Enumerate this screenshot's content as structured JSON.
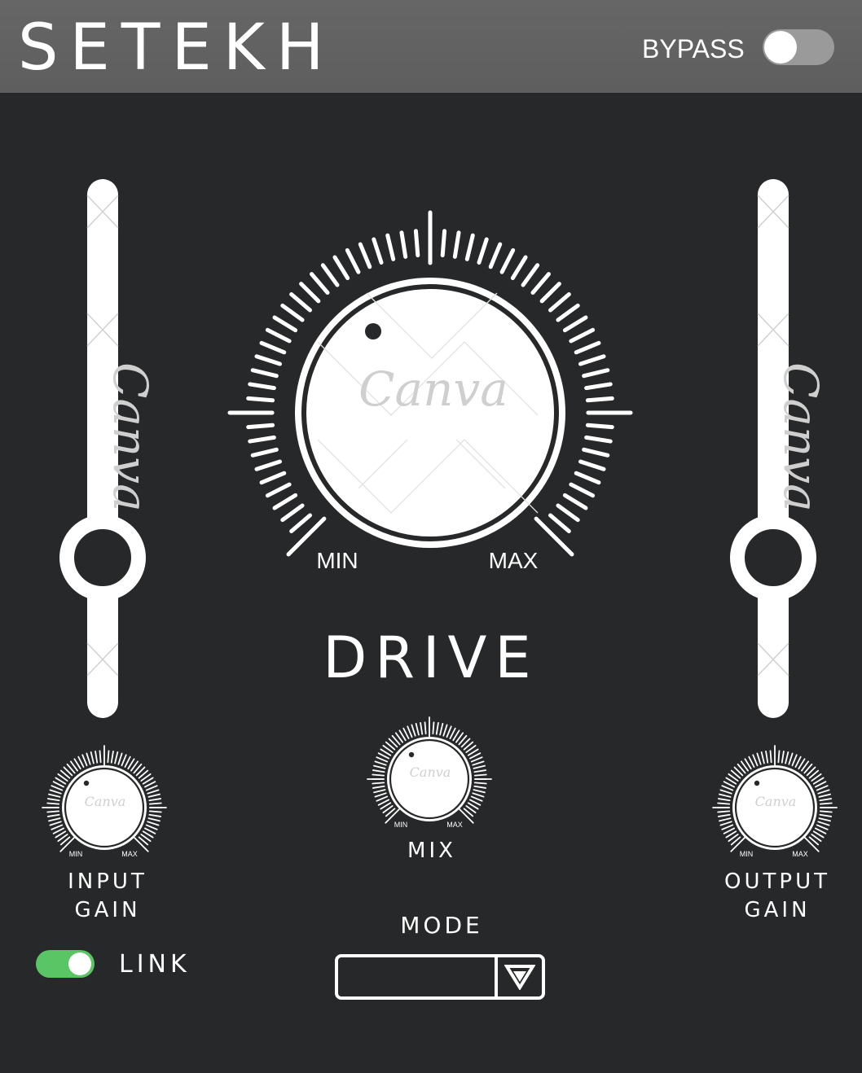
{
  "header": {
    "title": "SETEKH",
    "bypass_label": "BYPASS",
    "bypass_on": false
  },
  "drive": {
    "label": "DRIVE",
    "min_label": "MIN",
    "max_label": "MAX",
    "watermark": "Canva"
  },
  "mix": {
    "label": "MIX",
    "min_label": "MIN",
    "max_label": "MAX",
    "watermark": "Canva"
  },
  "input_gain": {
    "label_line1": "INPUT",
    "label_line2": "GAIN",
    "min_label": "MIN",
    "max_label": "MAX",
    "watermark": "Canva",
    "slider_watermark": "Canva"
  },
  "output_gain": {
    "label_line1": "OUTPUT",
    "label_line2": "GAIN",
    "min_label": "MIN",
    "max_label": "MAX",
    "watermark": "Canva",
    "slider_watermark": "Canva"
  },
  "link": {
    "label": "LINK",
    "on": true
  },
  "mode": {
    "label": "MODE",
    "value": ""
  },
  "colors": {
    "background": "#272829",
    "header": "#616161",
    "toggle_on": "#5ac565",
    "toggle_off": "#9a9a9a"
  },
  "icons": {
    "dropdown": "triangle-down-icon"
  }
}
